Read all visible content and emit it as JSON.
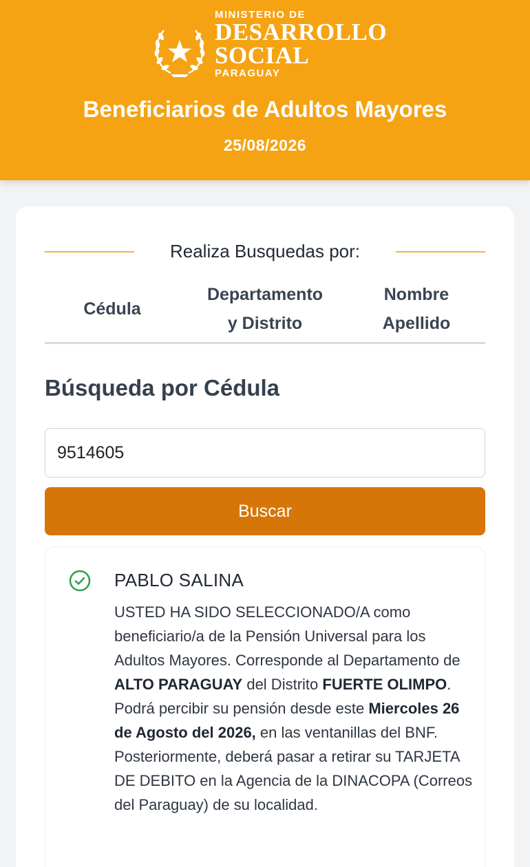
{
  "header": {
    "logo": {
      "line1": "MINISTERIO DE",
      "line2": "DESARROLLO",
      "line3": "SOCIAL",
      "line4": "PARAGUAY"
    },
    "title": "Beneficiarios de Adultos Mayores",
    "date": "25/08/2026",
    "background_color": "#f5a313"
  },
  "search_section": {
    "divider_label": "Realiza Busquedas por:",
    "tabs": [
      {
        "line1": "Cédula",
        "line2": ""
      },
      {
        "line1": "Departamento",
        "line2": "y Distrito"
      },
      {
        "line1": "Nombre",
        "line2": "Apellido"
      }
    ],
    "title": "Búsqueda por Cédula",
    "input_value": "9514605",
    "button_label": "Buscar",
    "button_color": "#d67608"
  },
  "result": {
    "status_icon": "check-circle-icon",
    "status_color": "#2e9e4f",
    "name": "PABLO SALINA",
    "segments": [
      {
        "text": "USTED HA SIDO SELECCIONADO/A como beneficiario/a de la Pensión Universal para los Adultos Mayores. Corresponde al Departamento de ",
        "bold": false
      },
      {
        "text": "ALTO PARAGUAY",
        "bold": true
      },
      {
        "text": " del Distrito ",
        "bold": false
      },
      {
        "text": "FUERTE OLIMPO",
        "bold": true
      },
      {
        "text": ". Podrá percibir su pensión desde este ",
        "bold": false
      },
      {
        "text": "Miercoles 26 de Agosto del 2026,",
        "bold": true
      },
      {
        "text": " en las ventanillas del BNF. Posteriormente, deberá pasar a retirar su TARJETA DE DEBITO en la Agencia de la DINACOPA (Correos del Paraguay) de su localidad.",
        "bold": false
      }
    ]
  }
}
